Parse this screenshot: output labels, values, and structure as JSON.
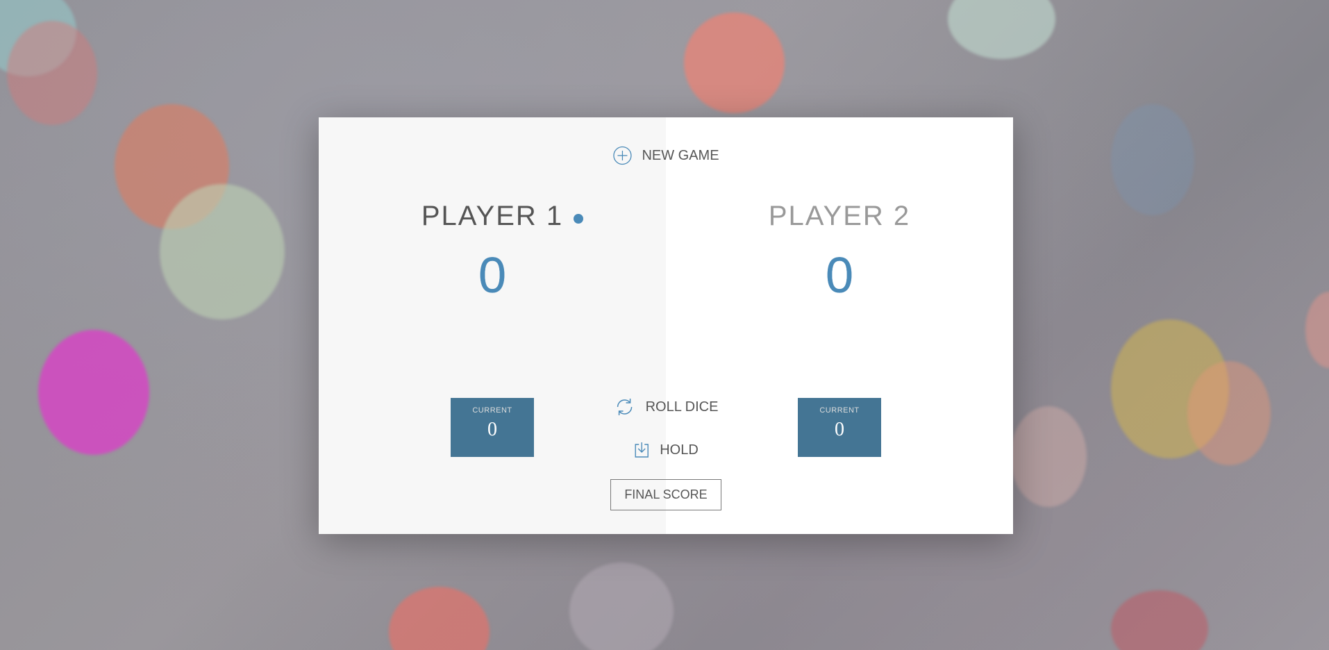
{
  "buttons": {
    "new_game": "New game",
    "roll_dice": "Roll dice",
    "hold": "Hold"
  },
  "final_score": {
    "placeholder": "Final score"
  },
  "players": [
    {
      "name": "Player 1",
      "score": "0",
      "current_label": "Current",
      "current_score": "0",
      "active": true
    },
    {
      "name": "Player 2",
      "score": "0",
      "current_label": "Current",
      "current_score": "0",
      "active": false
    }
  ],
  "colors": {
    "accent": "#4a8ab8",
    "current_box": "#447594",
    "panel_left": "#f7f7f7",
    "panel_right": "#ffffff"
  },
  "icons": {
    "new_game": "plus-circle-icon",
    "roll_dice": "refresh-icon",
    "hold": "download-icon",
    "active_player": "active-dot-icon"
  }
}
